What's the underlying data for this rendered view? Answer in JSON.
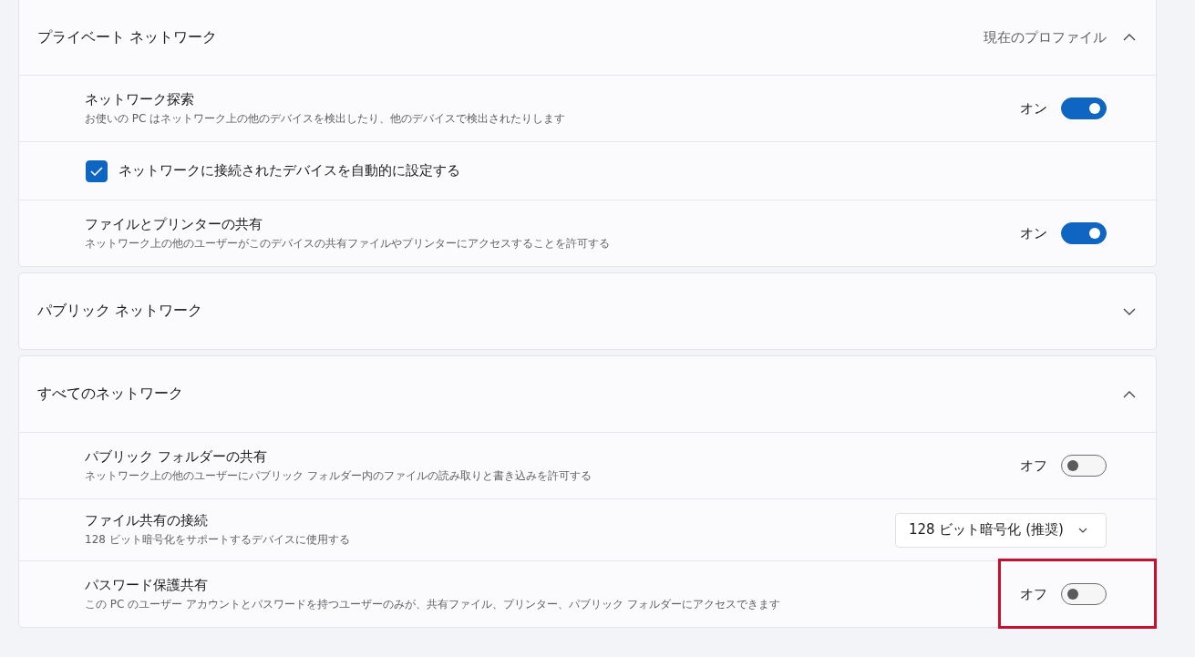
{
  "sections": [
    {
      "title": "プライベート ネットワーク",
      "trailing_text": "現在のプロファイル",
      "expanded": true,
      "items": [
        {
          "kind": "toggle",
          "title": "ネットワーク探索",
          "description": "お使いの PC はネットワーク上の他のデバイスを検出したり、他のデバイスで検出されたりします",
          "state_label": "オン",
          "on": true
        },
        {
          "kind": "checkbox",
          "label": "ネットワークに接続されたデバイスを自動的に設定する",
          "checked": true
        },
        {
          "kind": "toggle",
          "title": "ファイルとプリンターの共有",
          "description": "ネットワーク上の他のユーザーがこのデバイスの共有ファイルやプリンターにアクセスすることを許可する",
          "state_label": "オン",
          "on": true
        }
      ]
    },
    {
      "title": "パブリック ネットワーク",
      "expanded": false
    },
    {
      "title": "すべてのネットワーク",
      "expanded": true,
      "items": [
        {
          "kind": "toggle",
          "title": "パブリック フォルダーの共有",
          "description": "ネットワーク上の他のユーザーにパブリック フォルダー内のファイルの読み取りと書き込みを許可する",
          "state_label": "オフ",
          "on": false
        },
        {
          "kind": "dropdown",
          "title": "ファイル共有の接続",
          "description": "128 ビット暗号化をサポートするデバイスに使用する",
          "value": "128 ビット暗号化 (推奨)"
        },
        {
          "kind": "toggle",
          "title": "パスワード保護共有",
          "description": "この PC のユーザー アカウントとパスワードを持つユーザーのみが、共有ファイル、プリンター、パブリック フォルダーにアクセスできます",
          "state_label": "オフ",
          "on": false,
          "highlighted": true
        }
      ]
    }
  ]
}
